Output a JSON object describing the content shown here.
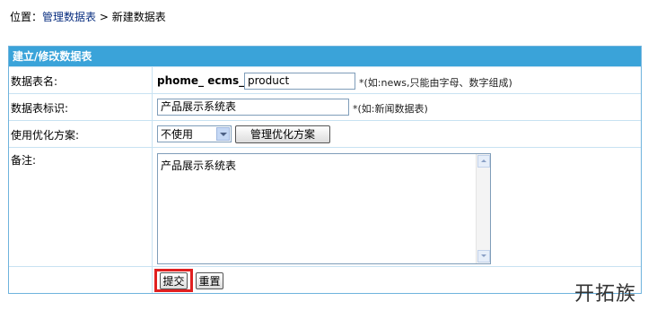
{
  "breadcrumb": {
    "prefix": "位置：",
    "link": "管理数据表",
    "separator": " > ",
    "current": "新建数据表"
  },
  "form": {
    "header": "建立/修改数据表",
    "table_name": {
      "label": "数据表名:",
      "prefix": "phome_ ecms_",
      "value": "product",
      "hint": "*(如:news,只能由字母、数字组成)"
    },
    "table_title": {
      "label": "数据表标识:",
      "value": "产品展示系统表",
      "hint": "*(如:新闻数据表)"
    },
    "optimize": {
      "label": "使用优化方案:",
      "selected": "不使用",
      "manage_button": "管理优化方案"
    },
    "note": {
      "label": "备注:",
      "value": "产品展示系统表"
    },
    "buttons": {
      "submit": "提交",
      "reset": "重置"
    }
  },
  "watermark": "开拓族",
  "colors": {
    "header_bg": "#3aa3d9",
    "border": "#6fb3dd",
    "highlight": "#e02020",
    "link": "#0a2f80"
  }
}
